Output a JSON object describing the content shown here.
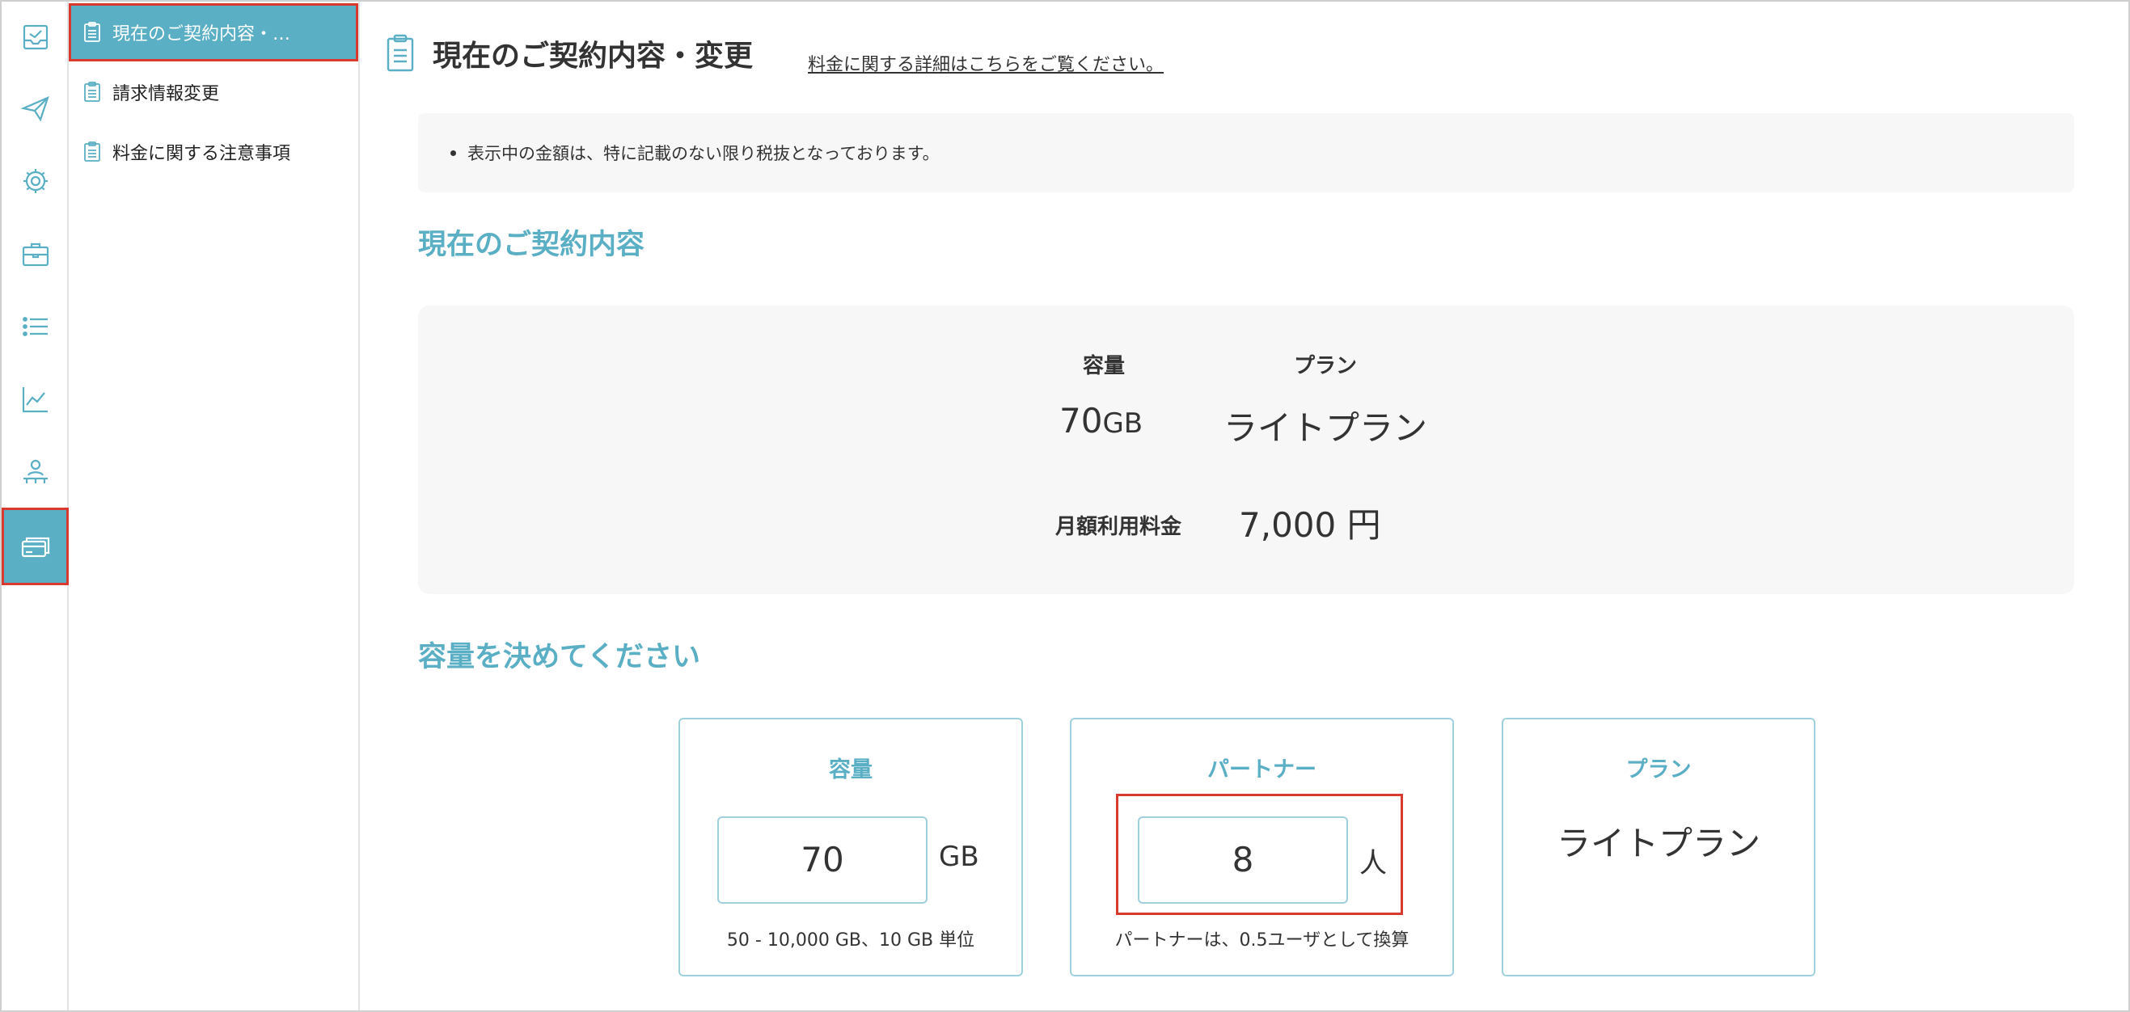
{
  "nav_rail": {
    "items": [
      {
        "icon": "inbox-tray-icon"
      },
      {
        "icon": "paper-plane-icon"
      },
      {
        "icon": "gear-icon"
      },
      {
        "icon": "briefcase-icon"
      },
      {
        "icon": "list-icon"
      },
      {
        "icon": "line-chart-icon"
      },
      {
        "icon": "org-person-icon"
      },
      {
        "icon": "credit-card-icon",
        "active": true
      }
    ]
  },
  "submenu": {
    "items": [
      {
        "label": "現在のご契約内容・…",
        "active": true
      },
      {
        "label": "請求情報変更"
      },
      {
        "label": "料金に関する注意事項"
      }
    ]
  },
  "header": {
    "title": "現在のご契約内容・変更",
    "detail_link": "料金に関する詳細はこちらをご覧ください。"
  },
  "notice": {
    "text": "表示中の金額は、特に記載のない限り税抜となっております。"
  },
  "current_contract": {
    "section_title": "現在のご契約内容",
    "capacity_label": "容量",
    "capacity_value": "70",
    "capacity_unit": "GB",
    "plan_label": "プラン",
    "plan_value": "ライトプラン",
    "monthly_fee_label": "月額利用料金",
    "monthly_fee_value": "7,000",
    "monthly_fee_unit": "円"
  },
  "capacity_selection": {
    "section_title": "容量を決めてください",
    "capacity_card": {
      "title": "容量",
      "value": "70",
      "unit": "GB",
      "hint": "50 - 10,000 GB、10 GB 単位"
    },
    "partner_card": {
      "title": "パートナー",
      "value": "8",
      "unit": "人",
      "hint": "パートナーは、0.5ユーザとして換算"
    },
    "plan_card": {
      "title": "プラン",
      "value": "ライトプラン"
    }
  },
  "colors": {
    "accent": "#5aafc4",
    "highlight": "#d93a30",
    "panel_bg": "#f7f7f7"
  }
}
